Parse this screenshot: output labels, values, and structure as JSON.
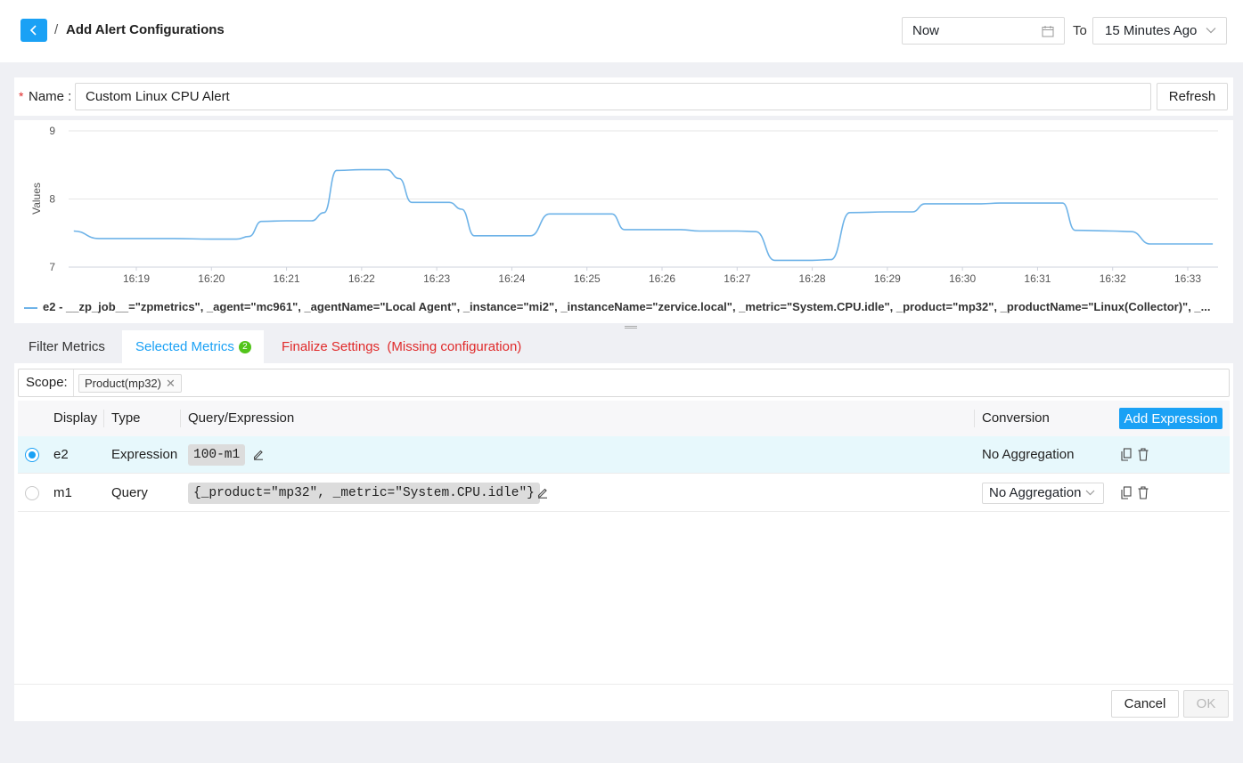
{
  "header": {
    "title": "Add Alert Configurations",
    "separator": "/",
    "time_from": "Now",
    "to_label": "To",
    "time_to": "15 Minutes Ago"
  },
  "name_row": {
    "required_mark": "*",
    "label": "Name :",
    "value": "Custom Linux CPU Alert",
    "refresh_label": "Refresh"
  },
  "chart_data": {
    "type": "line",
    "ylabel": "Values",
    "xlabel": "",
    "ylim": [
      7,
      9
    ],
    "y_ticks": [
      "9",
      "8",
      "7"
    ],
    "x_ticks": [
      "16:19",
      "16:20",
      "16:21",
      "16:22",
      "16:23",
      "16:24",
      "16:25",
      "16:26",
      "16:27",
      "16:28",
      "16:29",
      "16:30",
      "16:31",
      "16:32",
      "16:33"
    ],
    "grid": true,
    "legend_position": "bottom",
    "series": [
      {
        "name": "e2 - __zp_job__=\"zpmetrics\", _agent=\"mc961\", _agentName=\"Local Agent\", _instance=\"mi2\", _instanceName=\"zervice.local\", _metric=\"System.CPU.idle\", _product=\"mp32\", _productName=\"Linux(Collector)\", _...",
        "color": "#6eb3e8",
        "points": [
          [
            "16:18:10",
            7.53
          ],
          [
            "16:18:30",
            7.42
          ],
          [
            "16:19:00",
            7.42
          ],
          [
            "16:19:30",
            7.42
          ],
          [
            "16:20:00",
            7.41
          ],
          [
            "16:20:20",
            7.41
          ],
          [
            "16:20:30",
            7.45
          ],
          [
            "16:20:40",
            7.67
          ],
          [
            "16:21:00",
            7.68
          ],
          [
            "16:21:20",
            7.68
          ],
          [
            "16:21:30",
            7.8
          ],
          [
            "16:21:40",
            8.42
          ],
          [
            "16:22:00",
            8.43
          ],
          [
            "16:22:20",
            8.43
          ],
          [
            "16:22:30",
            8.3
          ],
          [
            "16:22:40",
            7.95
          ],
          [
            "16:23:00",
            7.95
          ],
          [
            "16:23:10",
            7.95
          ],
          [
            "16:23:20",
            7.85
          ],
          [
            "16:23:30",
            7.46
          ],
          [
            "16:24:00",
            7.46
          ],
          [
            "16:24:15",
            7.46
          ],
          [
            "16:24:30",
            7.78
          ],
          [
            "16:25:00",
            7.78
          ],
          [
            "16:25:20",
            7.78
          ],
          [
            "16:25:30",
            7.55
          ],
          [
            "16:26:00",
            7.55
          ],
          [
            "16:26:15",
            7.55
          ],
          [
            "16:26:30",
            7.53
          ],
          [
            "16:27:00",
            7.53
          ],
          [
            "16:27:15",
            7.52
          ],
          [
            "16:27:30",
            7.1
          ],
          [
            "16:28:00",
            7.1
          ],
          [
            "16:28:15",
            7.11
          ],
          [
            "16:28:30",
            7.8
          ],
          [
            "16:29:00",
            7.81
          ],
          [
            "16:29:20",
            7.81
          ],
          [
            "16:29:30",
            7.93
          ],
          [
            "16:30:00",
            7.93
          ],
          [
            "16:30:15",
            7.93
          ],
          [
            "16:30:30",
            7.94
          ],
          [
            "16:31:00",
            7.94
          ],
          [
            "16:31:20",
            7.94
          ],
          [
            "16:31:30",
            7.54
          ],
          [
            "16:32:00",
            7.53
          ],
          [
            "16:32:15",
            7.52
          ],
          [
            "16:32:30",
            7.34
          ],
          [
            "16:33:00",
            7.34
          ],
          [
            "16:33:20",
            7.34
          ]
        ]
      }
    ]
  },
  "tabs": [
    {
      "label": "Filter Metrics"
    },
    {
      "label": "Selected Metrics",
      "badge": "2"
    },
    {
      "label": "Finalize Settings  (Missing configuration)"
    }
  ],
  "scope": {
    "label": "Scope:",
    "tag": "Product(mp32)"
  },
  "table": {
    "headers": {
      "display": "Display",
      "type": "Type",
      "query": "Query/Expression",
      "conversion": "Conversion"
    },
    "add_button": "Add Expression",
    "rows": [
      {
        "selected": true,
        "display": "e2",
        "type": "Expression",
        "query": "100-m1",
        "conversion": "No Aggregation"
      },
      {
        "selected": false,
        "display": "m1",
        "type": "Query",
        "query": "{_product=\"mp32\", _metric=\"System.CPU.idle\"}",
        "conversion": "No Aggregation"
      }
    ]
  },
  "footer": {
    "cancel": "Cancel",
    "ok": "OK"
  },
  "colors": {
    "accent": "#1aa1f5",
    "danger": "#e02a2a",
    "success_badge": "#52c41a",
    "series_line": "#6eb3e8",
    "selected_row": "#e7f8fc"
  }
}
